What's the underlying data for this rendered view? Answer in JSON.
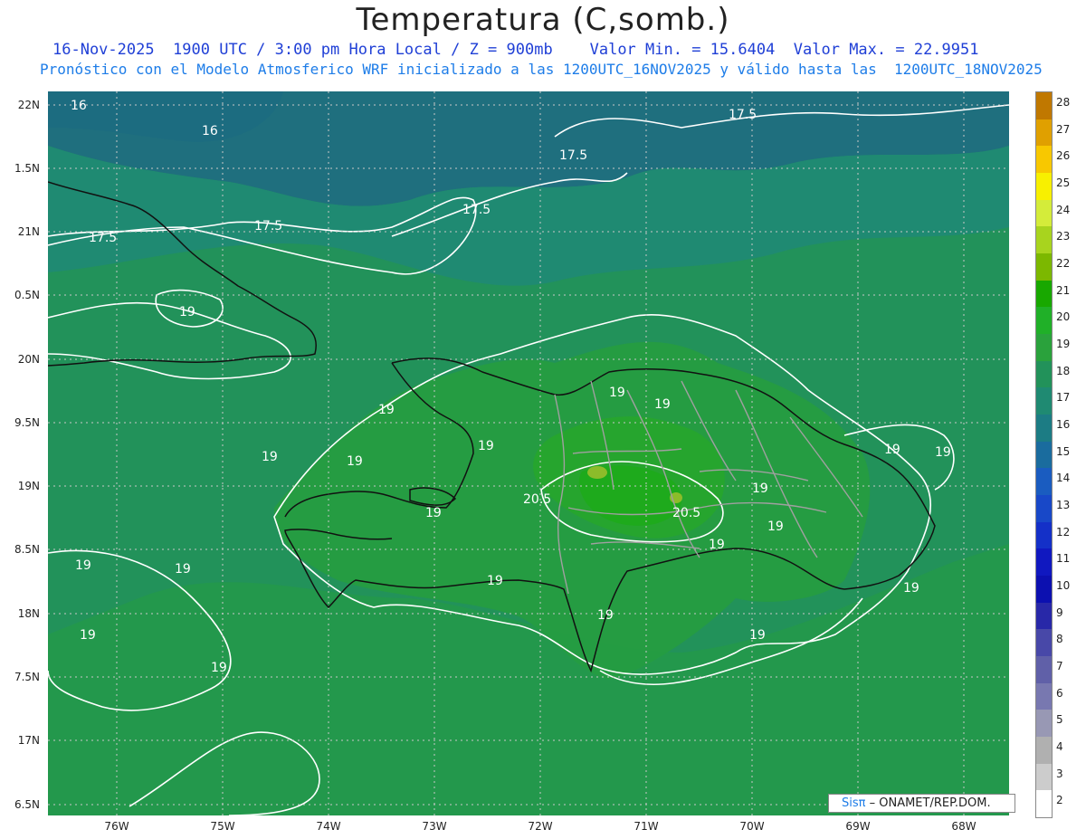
{
  "header": {
    "title": "Temperatura (C,somb.)",
    "line1": "16-Nov-2025  1900 UTC / 3:00 pm Hora Local / Z = 900mb    Valor Min. = 15.6404  Valor Max. = 22.9951",
    "line2": "Pronóstico con el Modelo Atmosferico WRF inicializado a las 1200UTC_16NOV2025 y válido hasta las  1200UTC_18NOV2025"
  },
  "axes": {
    "lat_labels": [
      "22N",
      "1.5N",
      "21N",
      "0.5N",
      "20N",
      "9.5N",
      "19N",
      "8.5N",
      "18N",
      "7.5N",
      "17N",
      "6.5N"
    ],
    "lon_labels": [
      "76W",
      "75W",
      "74W",
      "73W",
      "72W",
      "71W",
      "70W",
      "69W",
      "68W"
    ]
  },
  "contour_labels": [
    "16",
    "16",
    "17.5",
    "17.5",
    "17.5",
    "17.5",
    "17.5",
    "19",
    "19",
    "19",
    "19",
    "19",
    "19",
    "19",
    "19",
    "19",
    "19",
    "19",
    "19",
    "19",
    "19",
    "19",
    "19",
    "19",
    "19",
    "19",
    "19",
    "19",
    "20.5",
    "20.5"
  ],
  "colorbar": {
    "levels": [
      "28",
      "27",
      "26",
      "25",
      "24",
      "23",
      "22",
      "21",
      "20",
      "19",
      "18",
      "17",
      "16",
      "15",
      "14",
      "13",
      "12",
      "11",
      "10",
      "9",
      "8",
      "7",
      "6",
      "5",
      "4",
      "3",
      "2"
    ],
    "colors": [
      "#c07800",
      "#e0a000",
      "#f8c800",
      "#f8f000",
      "#d4ec3a",
      "#a8d41e",
      "#7cb800",
      "#18a800",
      "#20b028",
      "#2aa23c",
      "#22925a",
      "#1f8a72",
      "#1c7c84",
      "#1a6c9e",
      "#1a5cc0",
      "#1848c8",
      "#1430c8",
      "#1018c0",
      "#0c10b0",
      "#2828a8",
      "#4848a8",
      "#6060a8",
      "#7878b0",
      "#9898b4",
      "#b0b0b0",
      "#cccccc",
      "#ffffff"
    ]
  },
  "field_colors": {
    "cold": "#1f6f7e",
    "cool": "#1f8a72",
    "mid": "#22925a",
    "warm": "#259c42",
    "hot": "#26a52e",
    "hotter": "#1eaa1c",
    "peak": "#8cbc2a"
  },
  "credit": {
    "brand": "Sisπ",
    "dash": " – ",
    "org": "ONAMET/REP.DOM."
  }
}
